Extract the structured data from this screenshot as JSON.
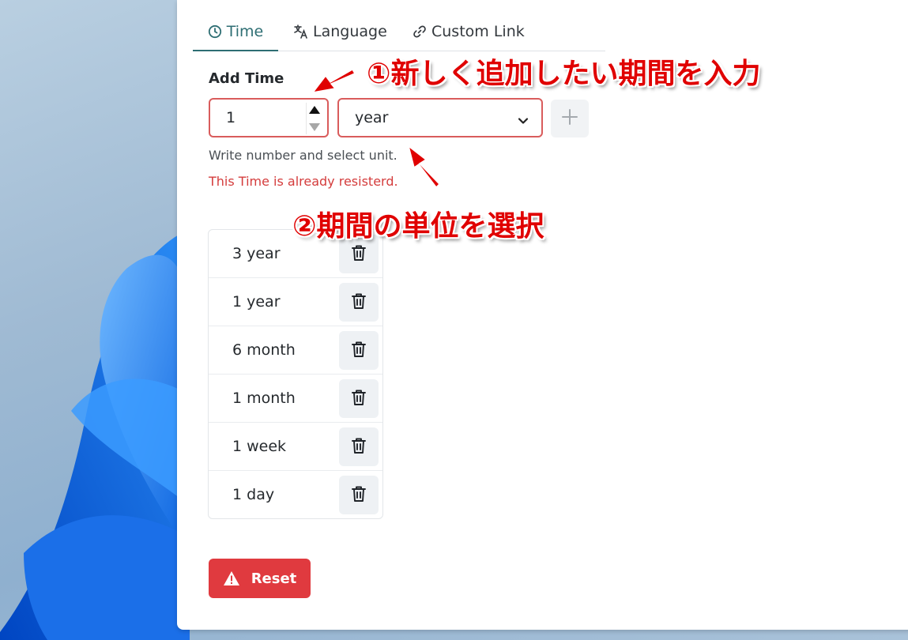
{
  "tabs": [
    {
      "label": "Time",
      "icon": "clock-icon",
      "active": true
    },
    {
      "label": "Language",
      "icon": "translate-icon",
      "active": false
    },
    {
      "label": "Custom Link",
      "icon": "link-icon",
      "active": false
    }
  ],
  "add_time": {
    "title": "Add Time",
    "number_value": "1",
    "unit_value": "year",
    "help_text": "Write number and select unit.",
    "error_text": "This Time is already resisterd."
  },
  "time_items": [
    {
      "label": "3 year"
    },
    {
      "label": "1 year"
    },
    {
      "label": "6 month"
    },
    {
      "label": "1 month"
    },
    {
      "label": "1 week"
    },
    {
      "label": "1 day"
    }
  ],
  "reset": {
    "label": "Reset",
    "icon": "warning-triangle-icon"
  },
  "annotations": {
    "step1": "①新しく追加したい期間を入力",
    "step2": "②期間の単位を選択"
  },
  "colors": {
    "accent": "#2e6e73",
    "error": "#d43c3c",
    "danger_button": "#e03a3f",
    "annotation": "#e00000"
  }
}
